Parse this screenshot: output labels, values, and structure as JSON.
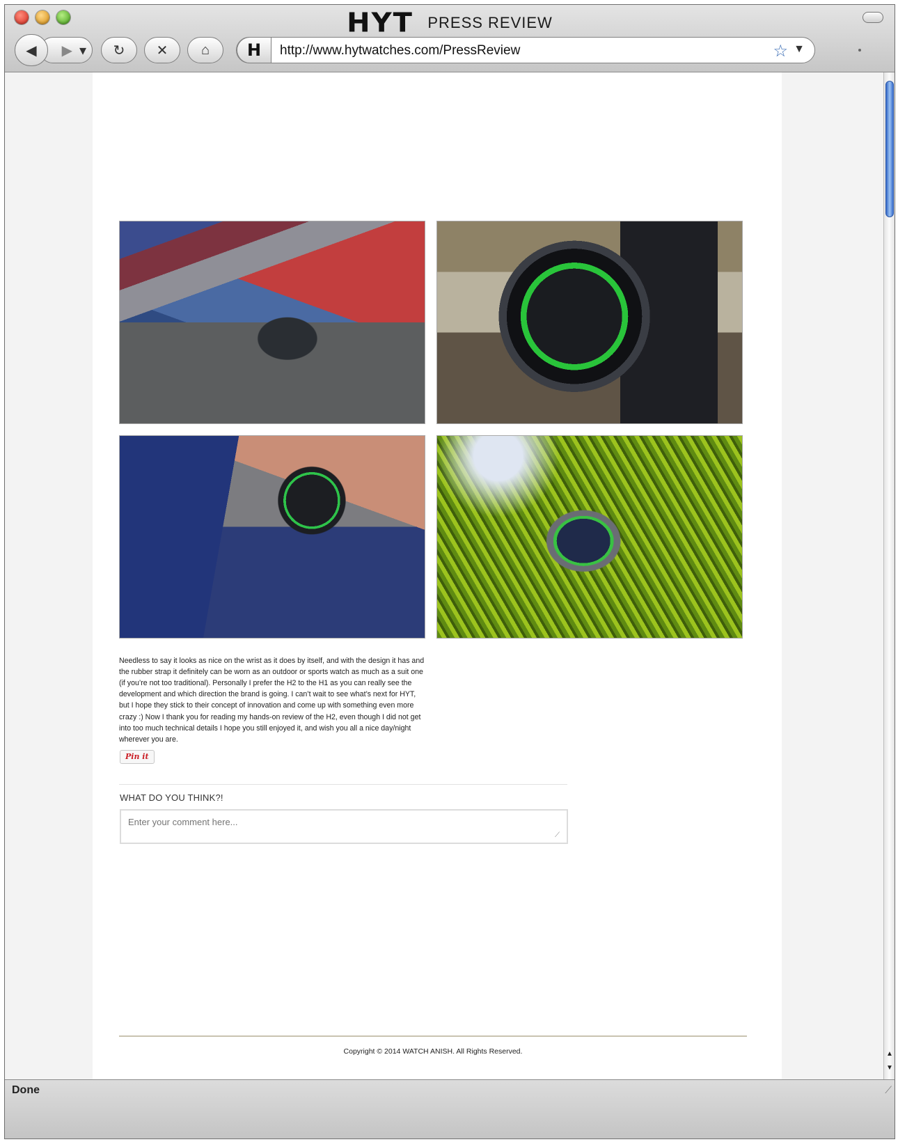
{
  "window": {
    "brand": "HYT",
    "title": "PRESS REVIEW",
    "url": "http://www.hytwatches.com/PressReview",
    "site_icon_letter": "H",
    "status": "Done"
  },
  "toolbar": {
    "back_glyph": "◀",
    "forward_glyph": "▶",
    "forward_menu_glyph": "▾",
    "reload_glyph": "↻",
    "stop_glyph": "✕",
    "home_glyph": "⌂",
    "bookmark_glyph": "☆",
    "url_menu_glyph": "▼"
  },
  "article": {
    "body": "Needless to say it looks as nice on the wrist as it does by itself, and with the design it has and the rubber strap it definitely can be worn as an outdoor or sports watch as much as a suit one (if you’re not too traditional). Personally I prefer the H2 to the H1 as you can really see the development and which direction the brand is going. I can’t wait to see what’s next for HYT, but I hope they stick to their concept of innovation and come up with something even more crazy :) Now I thank you for reading my hands-on review of the H2, even though I did not get into too much technical details I hope you still enjoyed it, and wish you all a nice day/night wherever you are.",
    "pin_label": "Pin it"
  },
  "comments": {
    "heading": "WHAT DO YOU THINK?!",
    "placeholder": "Enter your comment here..."
  },
  "footer": {
    "copyright": "Copyright © 2014 WATCH ANISH. All Rights Reserved."
  },
  "scrollbar": {
    "up_glyph": "▲",
    "down_glyph": "▼"
  },
  "colors": {
    "scroll_thumb": "#3a6fce",
    "pin_red": "#cb2027",
    "watch_green": "#29c43a"
  }
}
